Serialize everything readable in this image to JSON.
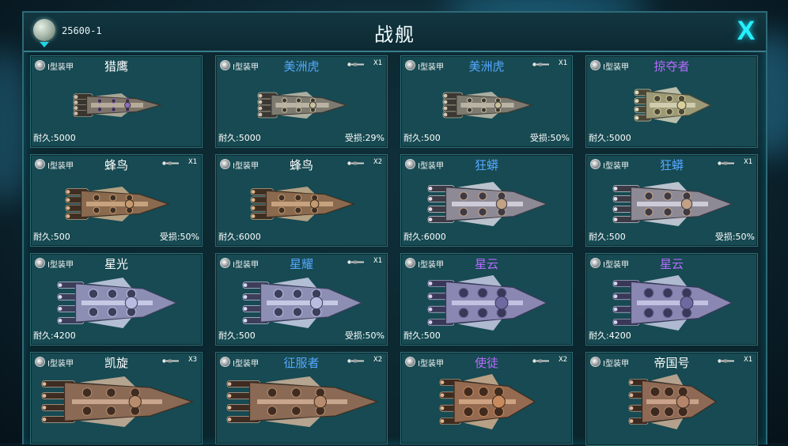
{
  "header": {
    "location": "25600-1",
    "title": "战舰",
    "close_label": "X"
  },
  "colors": {
    "accent": "#25f0ff",
    "name_white": "#ffffff",
    "name_blue": "#55a8ff",
    "name_purple": "#b66bff"
  },
  "ships": [
    {
      "armor": "I型装甲",
      "name": "猎鹰",
      "name_color": "white",
      "weapon_count": "",
      "durability": "耐久:5000",
      "damage": "",
      "hull": "falcon"
    },
    {
      "armor": "I型装甲",
      "name": "美洲虎",
      "name_color": "blue",
      "weapon_count": "X1",
      "durability": "耐久:5000",
      "damage": "受损:29%",
      "hull": "jaguar"
    },
    {
      "armor": "I型装甲",
      "name": "美洲虎",
      "name_color": "blue",
      "weapon_count": "X1",
      "durability": "耐久:500",
      "damage": "受损:50%",
      "hull": "jaguar"
    },
    {
      "armor": "I型装甲",
      "name": "掠夺者",
      "name_color": "purple",
      "weapon_count": "",
      "durability": "耐久:5000",
      "damage": "",
      "hull": "raider"
    },
    {
      "armor": "I型装甲",
      "name": "蜂鸟",
      "name_color": "white",
      "weapon_count": "X1",
      "durability": "耐久:500",
      "damage": "受损:50%",
      "hull": "hummingbird"
    },
    {
      "armor": "I型装甲",
      "name": "蜂鸟",
      "name_color": "white",
      "weapon_count": "X2",
      "durability": "耐久:6000",
      "damage": "",
      "hull": "hummingbird"
    },
    {
      "armor": "I型装甲",
      "name": "狂蟒",
      "name_color": "blue",
      "weapon_count": "",
      "durability": "耐久:6000",
      "damage": "",
      "hull": "python"
    },
    {
      "armor": "I型装甲",
      "name": "狂蟒",
      "name_color": "blue",
      "weapon_count": "X1",
      "durability": "耐久:500",
      "damage": "受损:50%",
      "hull": "python"
    },
    {
      "armor": "I型装甲",
      "name": "星光",
      "name_color": "white",
      "weapon_count": "",
      "durability": "耐久:4200",
      "damage": "",
      "hull": "starlight"
    },
    {
      "armor": "I型装甲",
      "name": "星耀",
      "name_color": "blue",
      "weapon_count": "X1",
      "durability": "耐久:500",
      "damage": "受损:50%",
      "hull": "starlight"
    },
    {
      "armor": "I型装甲",
      "name": "星云",
      "name_color": "purple",
      "weapon_count": "",
      "durability": "耐久:500",
      "damage": "",
      "hull": "nebula"
    },
    {
      "armor": "I型装甲",
      "name": "星云",
      "name_color": "purple",
      "weapon_count": "",
      "durability": "耐久:4200",
      "damage": "",
      "hull": "nebula"
    },
    {
      "armor": "I型装甲",
      "name": "凯旋",
      "name_color": "white",
      "weapon_count": "X3",
      "durability": "",
      "damage": "",
      "hull": "triumph"
    },
    {
      "armor": "I型装甲",
      "name": "征服者",
      "name_color": "blue",
      "weapon_count": "X2",
      "durability": "",
      "damage": "",
      "hull": "triumph"
    },
    {
      "armor": "I型装甲",
      "name": "使徒",
      "name_color": "purple",
      "weapon_count": "X2",
      "durability": "",
      "damage": "",
      "hull": "apostle"
    },
    {
      "armor": "I型装甲",
      "name": "帝国号",
      "name_color": "white",
      "weapon_count": "X1",
      "durability": "",
      "damage": "",
      "hull": "empire"
    }
  ]
}
